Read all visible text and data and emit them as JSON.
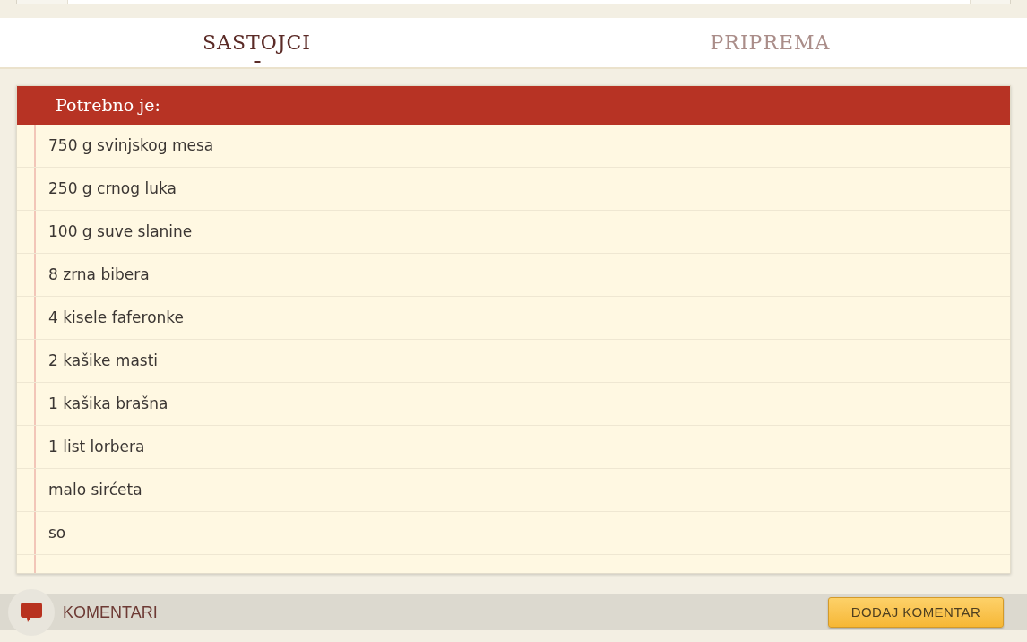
{
  "tabs": [
    {
      "label": "SASTOJCI",
      "selected": true
    },
    {
      "label": "PRIPREMA",
      "selected": false
    }
  ],
  "ingredients": {
    "title": "Potrebno je:",
    "items": [
      "750 g svinjskog mesa",
      "250 g crnog luka",
      "100 g suve slanine",
      "8 zrna bibera",
      "4 kisele faferonke",
      "2 kašike masti",
      "1 kašika brašna",
      "1 list lorbera",
      "malo sirćeta",
      "so"
    ]
  },
  "comments_bar": {
    "label": "KOMENTARI",
    "button": "DODAJ KOMENTAR"
  }
}
